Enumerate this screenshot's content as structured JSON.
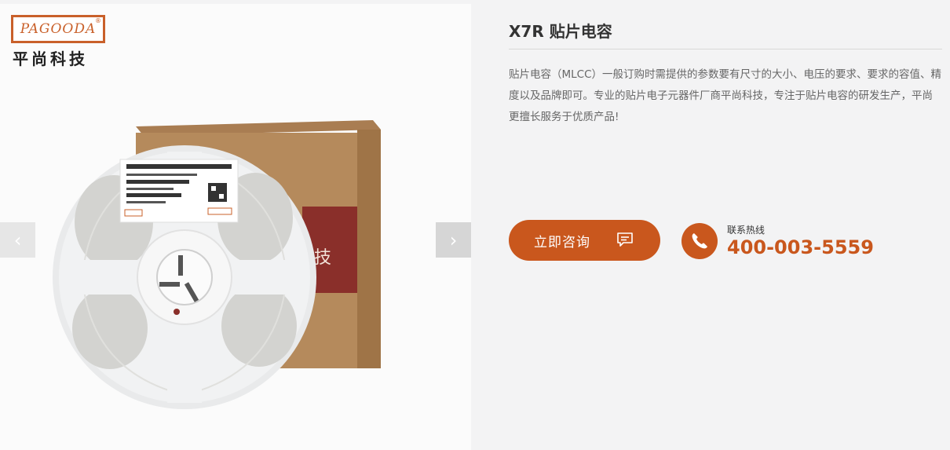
{
  "gallery": {
    "logo": {
      "brand": "PAGOODA",
      "reg": "®",
      "cn_name": "平尚科技"
    },
    "prev_label": "‹",
    "next_label": "›"
  },
  "product": {
    "title": "X7R 贴片电容",
    "description": "贴片电容（MLCC）一般订购时需提供的参数要有尺寸的大小、电压的要求、要求的容值、精度以及品牌即可。专业的贴片电子元器件厂商平尚科技，专注于贴片电容的研发生产，平尚更擅长服务于优质产品!",
    "consult_label": "立即咨询",
    "hotline_label": "联系热线",
    "hotline_number": "400-003-5559"
  },
  "colors": {
    "accent": "#c9571d",
    "logo": "#c9602a",
    "box": "#b58a5c"
  }
}
